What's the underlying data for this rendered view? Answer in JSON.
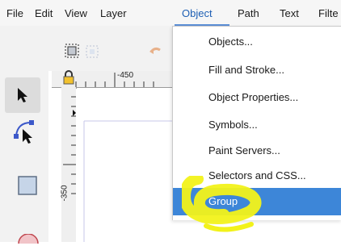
{
  "menubar": {
    "items": [
      "File",
      "Edit",
      "View",
      "Layer",
      "Object",
      "Path",
      "Text",
      "Filte"
    ],
    "active_index": 4
  },
  "ruler": {
    "h_label": "-450",
    "v_label": "-350"
  },
  "object_menu": {
    "items": [
      "Objects...",
      "Fill and Stroke...",
      "Object Properties...",
      "Symbols...",
      "Paint Servers...",
      "Selectors and CSS...",
      "Group"
    ],
    "selected_index": 6
  },
  "colors": {
    "menu_highlight": "#3d86d8",
    "annotation_marker": "#f2f21a",
    "active_menu_text": "#1e5fb4"
  },
  "icons": {
    "toolbar": [
      "document-icon",
      "select-all-icon",
      "select-in-layers-icon",
      "undo-icon"
    ],
    "toolbox": [
      "selector-arrow-icon",
      "node-editor-icon",
      "rectangle-tool-icon",
      "circle-tool-icon"
    ],
    "ruler": [
      "lock-icon"
    ]
  }
}
